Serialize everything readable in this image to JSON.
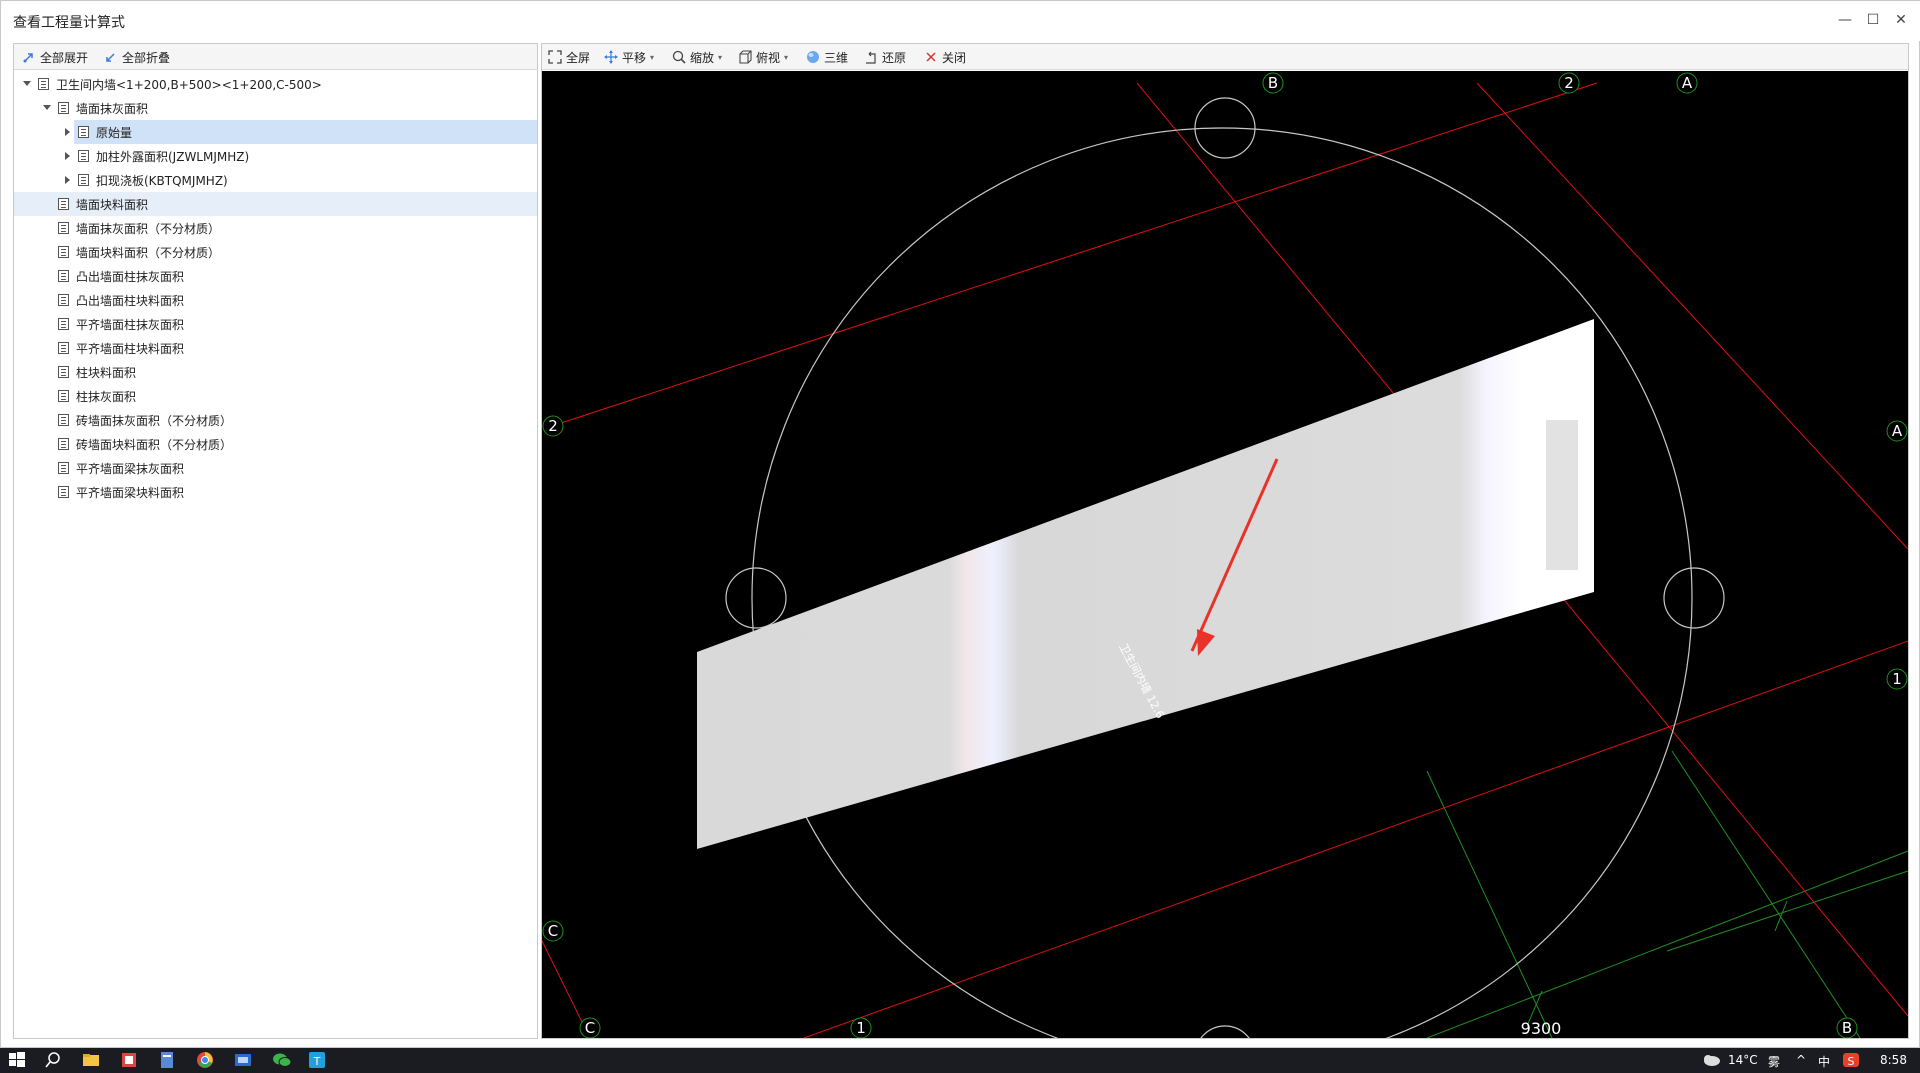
{
  "window": {
    "title": "查看工程量计算式",
    "minimize": "—",
    "maximize": "☐",
    "close": "✕"
  },
  "left_toolbar": {
    "expand_all": "全部展开",
    "collapse_all": "全部折叠"
  },
  "tree": [
    {
      "label": "卫生间内墙<1+200,B+500><1+200,C-500>",
      "level": 0,
      "toggle": "down",
      "state": ""
    },
    {
      "label": "墙面抹灰面积",
      "level": 1,
      "toggle": "down",
      "state": ""
    },
    {
      "label": "原始量",
      "level": 2,
      "toggle": "right",
      "state": "sel"
    },
    {
      "label": "加柱外露面积(JZWLMJMHZ)",
      "level": 2,
      "toggle": "right",
      "state": ""
    },
    {
      "label": "扣现浇板(KBTQMJMHZ)",
      "level": 2,
      "toggle": "right",
      "state": ""
    },
    {
      "label": "墙面块料面积",
      "level": 1,
      "toggle": "",
      "state": "hov"
    },
    {
      "label": "墙面抹灰面积（不分材质）",
      "level": 1,
      "toggle": "",
      "state": ""
    },
    {
      "label": "墙面块料面积（不分材质）",
      "level": 1,
      "toggle": "",
      "state": ""
    },
    {
      "label": "凸出墙面柱抹灰面积",
      "level": 1,
      "toggle": "",
      "state": ""
    },
    {
      "label": "凸出墙面柱块料面积",
      "level": 1,
      "toggle": "",
      "state": ""
    },
    {
      "label": "平齐墙面柱抹灰面积",
      "level": 1,
      "toggle": "",
      "state": ""
    },
    {
      "label": "平齐墙面柱块料面积",
      "level": 1,
      "toggle": "",
      "state": ""
    },
    {
      "label": "柱块料面积",
      "level": 1,
      "toggle": "",
      "state": ""
    },
    {
      "label": "柱抹灰面积",
      "level": 1,
      "toggle": "",
      "state": ""
    },
    {
      "label": "砖墙面抹灰面积（不分材质）",
      "level": 1,
      "toggle": "",
      "state": ""
    },
    {
      "label": "砖墙面块料面积（不分材质）",
      "level": 1,
      "toggle": "",
      "state": ""
    },
    {
      "label": "平齐墙面梁抹灰面积",
      "level": 1,
      "toggle": "",
      "state": ""
    },
    {
      "label": "平齐墙面梁块料面积",
      "level": 1,
      "toggle": "",
      "state": ""
    }
  ],
  "view_toolbar": {
    "fullscreen": "全屏",
    "pan": "平移",
    "zoom": "缩放",
    "top_view": "俯视",
    "three_d": "三维",
    "restore": "还原",
    "close": "关闭"
  },
  "viewport": {
    "axis_labels": {
      "b_top": "B",
      "two_top": "2",
      "a_top": "A",
      "two_left": "2",
      "a_right": "A",
      "one_right": "1",
      "c_left": "C",
      "c_bottom": "C",
      "one_bottom": "1",
      "b_bottom": "B"
    },
    "dimension": "9300",
    "element_label": "卫生间内墙 12.6"
  },
  "taskbar": {
    "temperature": "14°C",
    "weather": "雾",
    "ime": "中",
    "time": "8:58"
  },
  "colors": {
    "viewport_bg": "#000000",
    "axis_red": "#e01010",
    "axis_green": "#1f8f1f",
    "selection": "#cfe2f7",
    "arrow": "#e8322a"
  }
}
